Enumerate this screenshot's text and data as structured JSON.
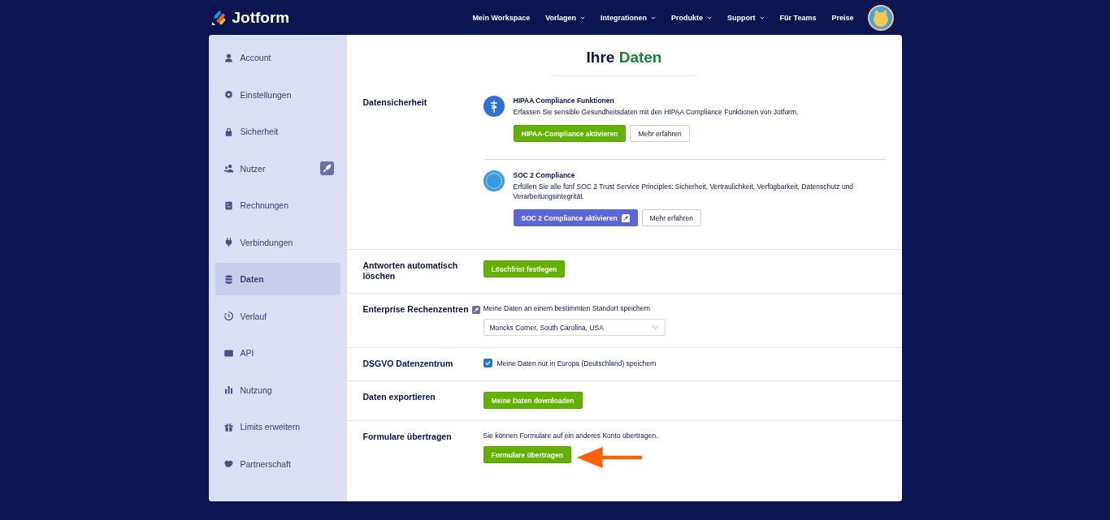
{
  "header": {
    "logo": "Jotform",
    "nav": [
      {
        "label": "Mein Workspace",
        "caret": false
      },
      {
        "label": "Vorlagen",
        "caret": true
      },
      {
        "label": "Integrationen",
        "caret": true
      },
      {
        "label": "Produkte",
        "caret": true
      },
      {
        "label": "Support",
        "caret": true
      },
      {
        "label": "Für Teams",
        "caret": false
      },
      {
        "label": "Preise",
        "caret": false
      }
    ]
  },
  "sidebar": {
    "items": [
      {
        "label": "Account",
        "selected": false,
        "upgrade": false
      },
      {
        "label": "Einstellungen",
        "selected": false,
        "upgrade": false
      },
      {
        "label": "Sicherheit",
        "selected": false,
        "upgrade": false
      },
      {
        "label": "Nutzer",
        "selected": false,
        "upgrade": true
      },
      {
        "label": "Rechnungen",
        "selected": false,
        "upgrade": false
      },
      {
        "label": "Verbindungen",
        "selected": false,
        "upgrade": false
      },
      {
        "label": "Daten",
        "selected": true,
        "upgrade": false
      },
      {
        "label": "Verlauf",
        "selected": false,
        "upgrade": false
      },
      {
        "label": "API",
        "selected": false,
        "upgrade": false
      },
      {
        "label": "Nutzung",
        "selected": false,
        "upgrade": false
      },
      {
        "label": "Limits erweitern",
        "selected": false,
        "upgrade": false
      },
      {
        "label": "Partnerschaft",
        "selected": false,
        "upgrade": false
      }
    ]
  },
  "page": {
    "title": "Ihre",
    "title_accent": "Daten"
  },
  "sections": [
    {
      "kind": "features",
      "label": "Datensicherheit",
      "upgrade": false,
      "features": [
        {
          "title": "HIPAA Compliance Funktionen",
          "description": "Erfassen Sie sensible Gesundheitsdaten mit den HIPAA Compliance Funktionen von Jotform.",
          "buttons": [
            {
              "label": "HIPAA-Compliance aktivieren",
              "kind": "primary"
            },
            {
              "label": "Mehr erfahren",
              "kind": "secondary"
            }
          ]
        },
        {
          "title": "SOC 2 Compliance",
          "description": "Erfüllen Sie alle fünf SOC 2 Trust Service Principles: Sicherheit, Vertraulichkeit, Verfügbarkeit, Datenschutz und Verarbeitungsintegrität.",
          "buttons": [
            {
              "label": "SOC 2 Compliance aktivieren",
              "kind": "premium"
            },
            {
              "label": "Mehr erfahren",
              "kind": "secondary"
            }
          ]
        }
      ]
    },
    {
      "kind": "button",
      "label": "Antworten automatisch löschen",
      "upgrade": false,
      "button": "Löschfrist festlegen"
    },
    {
      "kind": "select",
      "label": "Enterprise Rechenzentren",
      "upgrade": true,
      "text": "Meine Daten an einem bestimmten Standort speichern",
      "value": "Moncks Corner, South Carolina, USA"
    },
    {
      "kind": "checkbox",
      "label": "DSGVO Datenzentrum",
      "upgrade": false,
      "text": "Meine Daten nur in Europa (Deutschland) speichern",
      "checked": true
    },
    {
      "kind": "button",
      "label": "Daten exportieren",
      "upgrade": false,
      "button": "Meine Daten downloaden"
    },
    {
      "kind": "text-button",
      "label": "Formulare übertragen",
      "upgrade": false,
      "text": "Sie können Formulare auf ein anderes Konto übertragen.",
      "button": "Formulare übertragen",
      "arrow": true
    }
  ]
}
